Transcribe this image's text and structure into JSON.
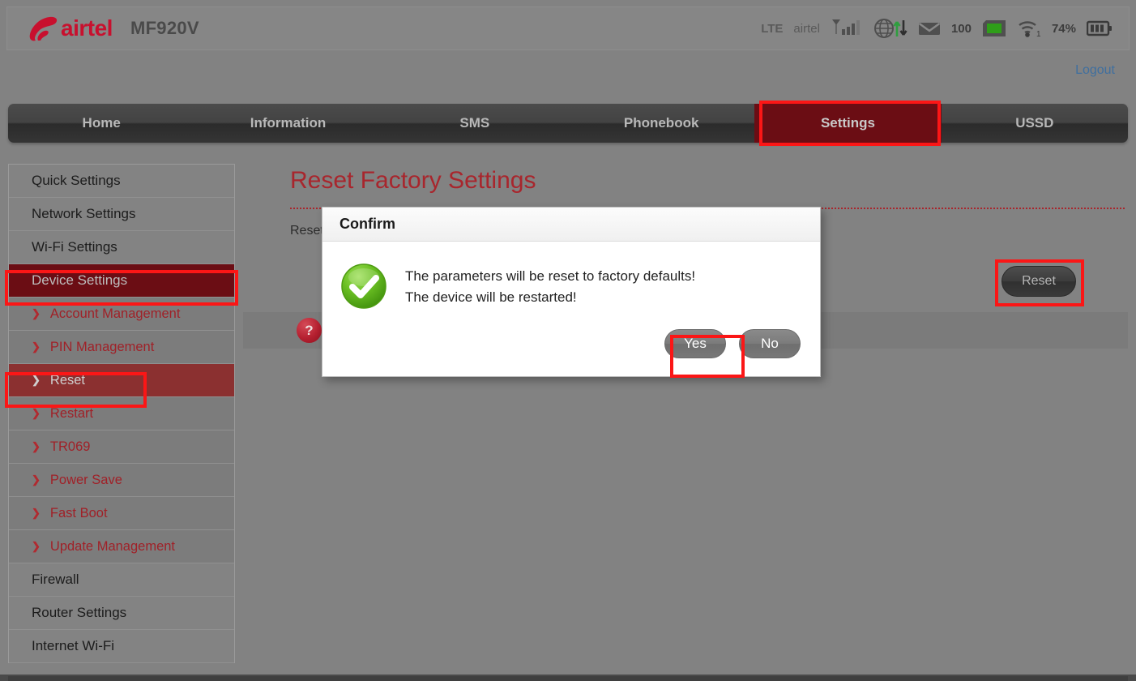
{
  "header": {
    "brand": "airtel",
    "brand_color": "#c8102e",
    "model": "MF920V",
    "status": {
      "network_type": "LTE",
      "operator": "airtel",
      "signal_icon": "signal-bars-icon",
      "globe_icon": "globe-data-transfer-icon",
      "mail_icon": "mail-icon",
      "mail_count": "100",
      "sim_icon": "sim-card-icon",
      "wifi_icon": "wifi-icon",
      "wifi_clients": "1",
      "battery_percent": "74%",
      "battery_icon": "battery-icon"
    }
  },
  "topbar": {
    "logout_label": "Logout",
    "logout_color": "#3f6f9f"
  },
  "nav": {
    "items": [
      {
        "label": "Home",
        "active": false
      },
      {
        "label": "Information",
        "active": false
      },
      {
        "label": "SMS",
        "active": false
      },
      {
        "label": "Phonebook",
        "active": false
      },
      {
        "label": "Settings",
        "active": true
      },
      {
        "label": "USSD",
        "active": false
      }
    ],
    "active_bg": "#6b0d14"
  },
  "sidebar": {
    "items": [
      {
        "label": "Quick Settings",
        "level": "top",
        "state": "normal"
      },
      {
        "label": "Network Settings",
        "level": "top",
        "state": "normal"
      },
      {
        "label": "Wi-Fi Settings",
        "level": "top",
        "state": "normal"
      },
      {
        "label": "Device Settings",
        "level": "top",
        "state": "selected-dark"
      },
      {
        "label": "Account Management",
        "level": "sub",
        "state": "normal"
      },
      {
        "label": "PIN Management",
        "level": "sub",
        "state": "normal"
      },
      {
        "label": "Reset",
        "level": "sub",
        "state": "selected-mid"
      },
      {
        "label": "Restart",
        "level": "sub",
        "state": "normal"
      },
      {
        "label": "TR069",
        "level": "sub",
        "state": "normal"
      },
      {
        "label": "Power Save",
        "level": "sub",
        "state": "normal"
      },
      {
        "label": "Fast Boot",
        "level": "sub",
        "state": "normal"
      },
      {
        "label": "Update Management",
        "level": "sub",
        "state": "normal"
      },
      {
        "label": "Firewall",
        "level": "top",
        "state": "normal"
      },
      {
        "label": "Router Settings",
        "level": "top",
        "state": "normal"
      },
      {
        "label": "Internet Wi-Fi",
        "level": "top",
        "state": "normal"
      }
    ],
    "chevron_glyph": "❯"
  },
  "main": {
    "page_title": "Reset Factory Settings",
    "title_color": "#a8262d",
    "row_label": "Reset",
    "reset_button_label": "Reset",
    "help_icon": "help-question-icon",
    "help_glyph": "?"
  },
  "dialog": {
    "title": "Confirm",
    "status_icon": "green-check-circle-icon",
    "message_line1": "The parameters will be reset to factory defaults!",
    "message_line2": "The device will be restarted!",
    "yes_label": "Yes",
    "no_label": "No"
  },
  "highlights": {
    "color": "#fb1616",
    "targets": [
      "settings-tab",
      "device-settings-sidebar-item",
      "reset-sidebar-item",
      "reset-button",
      "yes-button"
    ]
  }
}
